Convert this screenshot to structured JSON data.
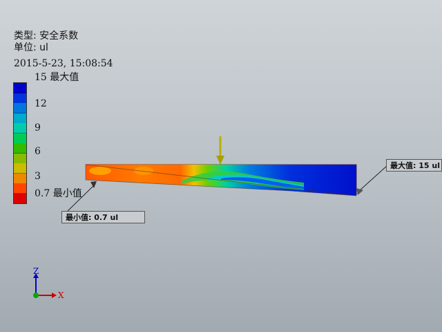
{
  "legend": {
    "type_line": "类型: 安全系数",
    "unit_line": "单位: ul",
    "timestamp": "2015-5-23, 15:08:54"
  },
  "colorbar": {
    "ticks": [
      {
        "value": "15",
        "suffix": "最大值"
      },
      {
        "value": "12",
        "suffix": ""
      },
      {
        "value": "9",
        "suffix": ""
      },
      {
        "value": "6",
        "suffix": ""
      },
      {
        "value": "3",
        "suffix": ""
      },
      {
        "value": "0.7",
        "suffix": "最小值"
      }
    ],
    "colors": [
      "#0000cc",
      "#0033dd",
      "#0077dd",
      "#00aacc",
      "#00ccaa",
      "#00cc55",
      "#33bb00",
      "#88bb00",
      "#ccbb00",
      "#ee8800",
      "#ff4400",
      "#dd0000"
    ]
  },
  "probes": {
    "min_label": "最小值: 0.7 ul",
    "max_label": "最大值: 15 ul"
  },
  "axes": {
    "x": "X",
    "z": "Z"
  },
  "colors": {
    "load_arrow": "#b8b000",
    "x_axis": "#cc0000",
    "z_axis": "#0000cc",
    "origin": "#00aa00"
  }
}
